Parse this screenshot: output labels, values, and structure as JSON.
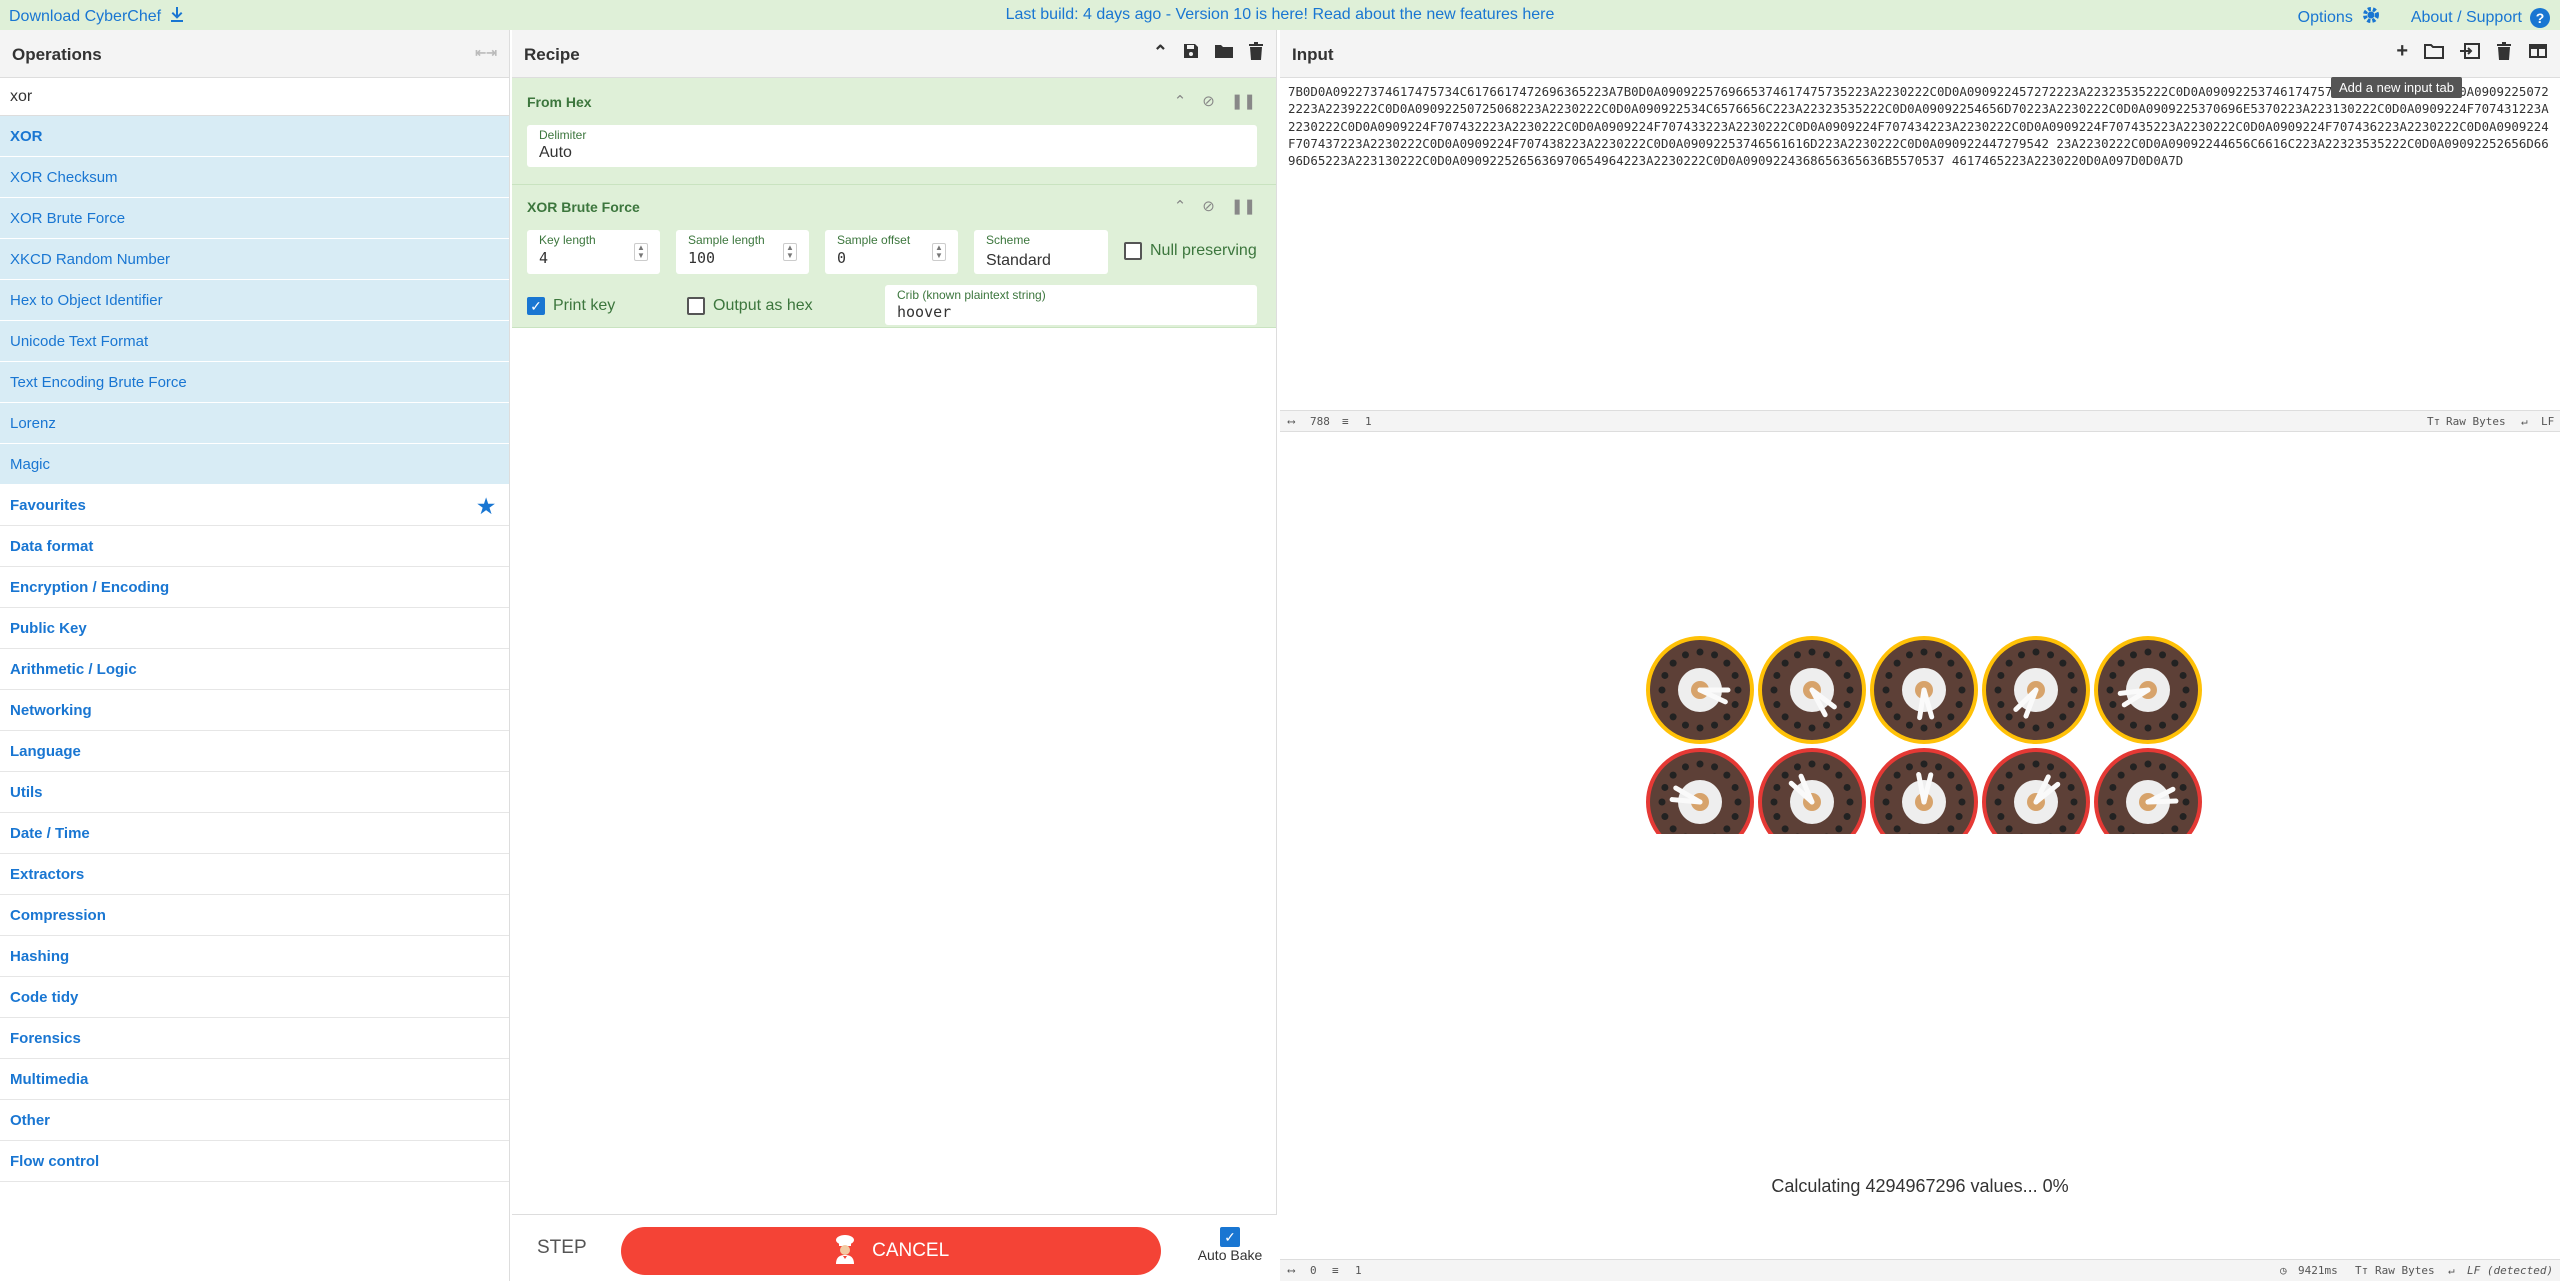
{
  "banner": {
    "download_label": "Download CyberChef",
    "build_message": "Last build: 4 days ago - Version 10 is here! Read about the new features here",
    "options_label": "Options",
    "about_label": "About / Support"
  },
  "operations": {
    "title": "Operations",
    "search_value": "xor",
    "results": [
      "XOR",
      "XOR Checksum",
      "XOR Brute Force",
      "XKCD Random Number",
      "Hex to Object Identifier",
      "Unicode Text Format",
      "Text Encoding Brute Force",
      "Lorenz",
      "Magic"
    ],
    "categories": [
      "Favourites",
      "Data format",
      "Encryption / Encoding",
      "Public Key",
      "Arithmetic / Logic",
      "Networking",
      "Language",
      "Utils",
      "Date / Time",
      "Extractors",
      "Compression",
      "Hashing",
      "Code tidy",
      "Forensics",
      "Multimedia",
      "Other",
      "Flow control"
    ]
  },
  "recipe": {
    "title": "Recipe",
    "from_hex": {
      "title": "From Hex",
      "delimiter_label": "Delimiter",
      "delimiter_value": "Auto"
    },
    "xor_brute": {
      "title": "XOR Brute Force",
      "key_length_label": "Key length",
      "key_length_value": "4",
      "sample_length_label": "Sample length",
      "sample_length_value": "100",
      "sample_offset_label": "Sample offset",
      "sample_offset_value": "0",
      "scheme_label": "Scheme",
      "scheme_value": "Standard",
      "null_preserving_label": "Null preserving",
      "print_key_label": "Print key",
      "output_hex_label": "Output as hex",
      "crib_label": "Crib (known plaintext string)",
      "crib_value": "hoover"
    },
    "step_label": "STEP",
    "cancel_label": "CANCEL",
    "autobake_label": "Auto Bake"
  },
  "input": {
    "title": "Input",
    "tooltip": "Add a new input tab",
    "text": "7B0D0A09227374617475734C6176617472696365223A7B0D0A0909225769665374617475735223A2230222C0D0A090922457272223A22323535222C0D0A0909225374617475734223A22312 22C0D0A09092250722223A2239222C0D0A09092250725068223A2230222C0D0A090922534C6576656C223A22323535222C0D0A09092254656D70223A2230222C0D0A0909225370696E5370223A223130222C0D0A0909224F707431223A2230222C0D0A0909224F707432223A2230222C0D0A0909224F707433223A2230222C0D0A0909224F707434223A2230222C0D0A0909224F707435223A2230222C0D0A0909224F707436223A2230222C0D0A0909224F707437223A2230222C0D0A0909224F707438223A2230222C0D0A09092253746561616D223A2230222C0D0A090922447279542 23A2230222C0D0A09092244656C6616C223A22323535222C0D0A09092252656D6696D65223A223130222C0D0A0909225265636970654964223A2230222C0D0A0909224368656365636B5570537 4617465223A2230220D0A097D0D0A7D",
    "status_length": "788",
    "status_lines": "1",
    "status_format": "Raw Bytes",
    "status_eol": "LF"
  },
  "output": {
    "calculating": "Calculating 4294967296 values... 0%",
    "status_length": "0",
    "status_lines": "1",
    "status_time": "9421ms",
    "status_format": "Raw Bytes",
    "status_eol": "LF (detected)",
    "loader_ring_colors": [
      "#ffc107",
      "#e53935",
      "#43a047"
    ]
  }
}
